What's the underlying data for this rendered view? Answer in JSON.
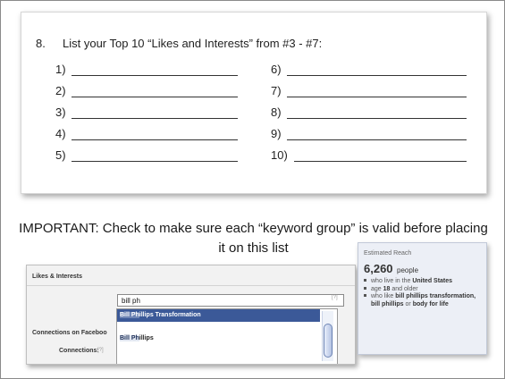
{
  "worksheet": {
    "question_number": "8.",
    "question_text": "List your Top 10 “Likes and Interests” from #3 - #7:",
    "entries": [
      {
        "number": "1)"
      },
      {
        "number": "2)"
      },
      {
        "number": "3)"
      },
      {
        "number": "4)"
      },
      {
        "number": "5)"
      },
      {
        "number": "6)"
      },
      {
        "number": "7)"
      },
      {
        "number": "8)"
      },
      {
        "number": "9)"
      },
      {
        "number": "10)"
      }
    ]
  },
  "important_note": "IMPORTANT: Check to make sure each “keyword group” is valid before placing it on this list",
  "facebook_form": {
    "section_title": "Likes & Interests",
    "input_value": "bill ph",
    "help_marker": "[?]",
    "suggestions": [
      {
        "match": "Bill Ph",
        "rest": "illips Transformation",
        "selected": true
      },
      {
        "match": "Bill Ph",
        "rest": "illips",
        "selected": false
      }
    ],
    "connections_title": "Connections on Faceboo",
    "connections_label": "Connections:",
    "connections_help": "[?]",
    "colors": {
      "selected_bg": "#3b5998",
      "highlight": "#6d84b4"
    }
  },
  "estimated_reach": {
    "title": "Estimated Reach",
    "count": "6,260",
    "unit": "people",
    "criteria": [
      {
        "pre": "who live in the ",
        "bold": "United States",
        "post": ""
      },
      {
        "pre": "age ",
        "bold": "18",
        "post": " and older"
      },
      {
        "pre": "who like ",
        "bold": "bill phillips transformation, bill phillips",
        "post": " or ",
        "bold2": "body for life"
      }
    ]
  }
}
